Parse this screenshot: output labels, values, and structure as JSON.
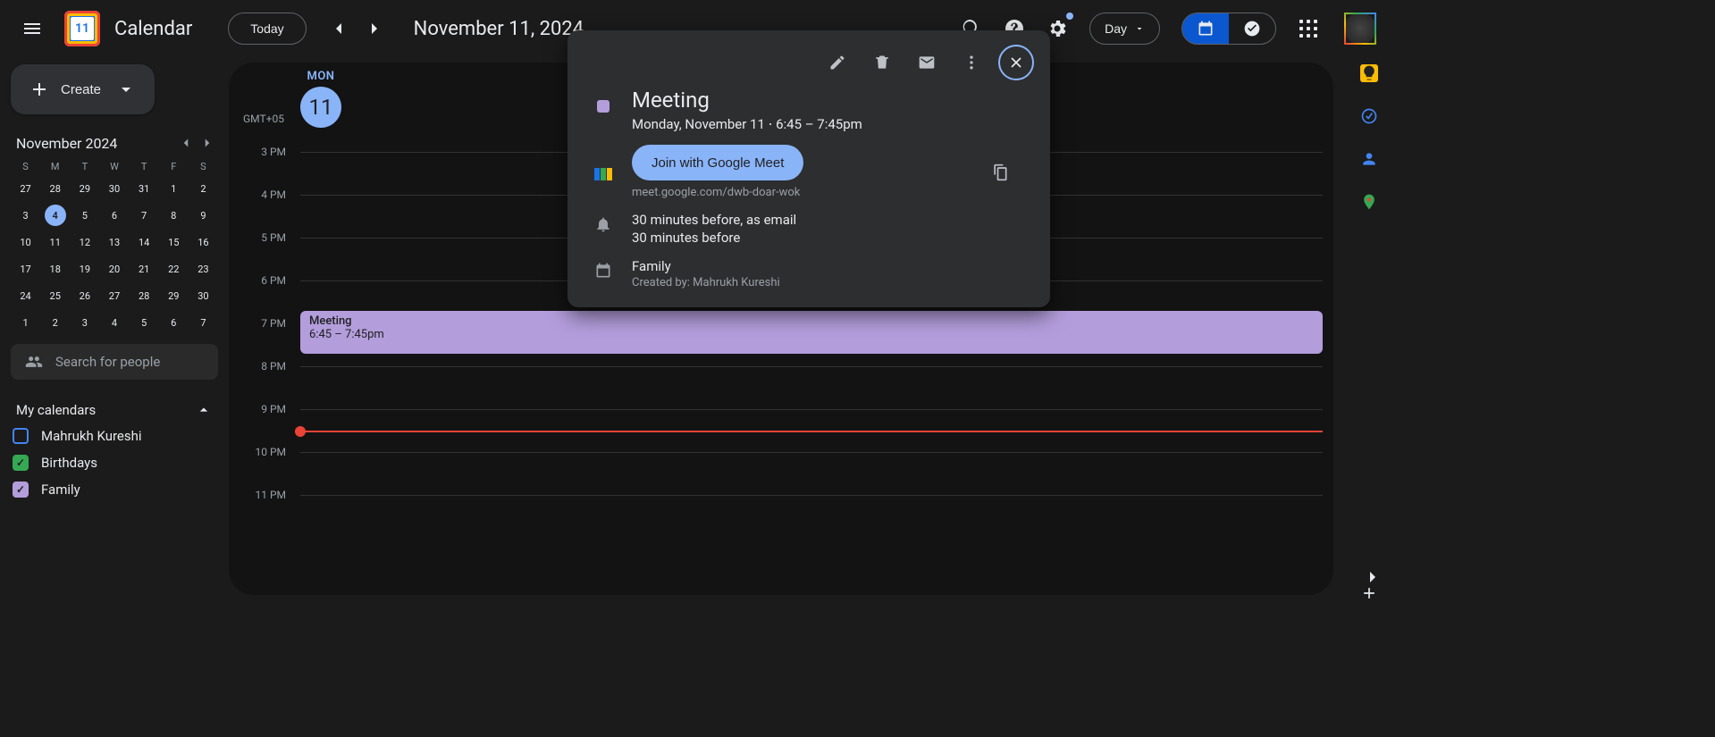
{
  "header": {
    "app_title": "Calendar",
    "logo_day": "11",
    "today_label": "Today",
    "month_title": "November 11, 2024",
    "view_label": "Day"
  },
  "sidebar": {
    "create_label": "Create",
    "mini_month": "November 2024",
    "dow": [
      "S",
      "M",
      "T",
      "W",
      "T",
      "F",
      "S"
    ],
    "days": [
      "27",
      "28",
      "29",
      "30",
      "31",
      "1",
      "2",
      "3",
      "4",
      "5",
      "6",
      "7",
      "8",
      "9",
      "10",
      "11",
      "12",
      "13",
      "14",
      "15",
      "16",
      "17",
      "18",
      "19",
      "20",
      "21",
      "22",
      "23",
      "24",
      "25",
      "26",
      "27",
      "28",
      "29",
      "30",
      "1",
      "2",
      "3",
      "4",
      "5",
      "6",
      "7"
    ],
    "today_index": 8,
    "search_placeholder": "Search for people",
    "section_title": "My calendars",
    "calendars": [
      {
        "label": "Mahrukh Kureshi",
        "color": "#4285f4",
        "checked": false
      },
      {
        "label": "Birthdays",
        "color": "#34a853",
        "checked": true
      },
      {
        "label": "Family",
        "color": "#b39ddb",
        "checked": true
      }
    ]
  },
  "day": {
    "dow": "MON",
    "num": "11",
    "tz": "GMT+05",
    "hour_labels": [
      "3 PM",
      "4 PM",
      "5 PM",
      "6 PM",
      "7 PM",
      "8 PM",
      "9 PM",
      "10 PM",
      "11 PM"
    ],
    "event": {
      "title": "Meeting",
      "time": "6:45 – 7:45pm"
    }
  },
  "popup": {
    "title": "Meeting",
    "date_line": "Monday, November 11  ⋅  6:45 – 7:45pm",
    "meet_button": "Join with Google Meet",
    "meet_link": "meet.google.com/dwb-doar-wok",
    "reminder_line1": "30 minutes before, as email",
    "reminder_line2": "30 minutes before",
    "calendar_name": "Family",
    "created_by": "Created by: Mahrukh Kureshi"
  }
}
